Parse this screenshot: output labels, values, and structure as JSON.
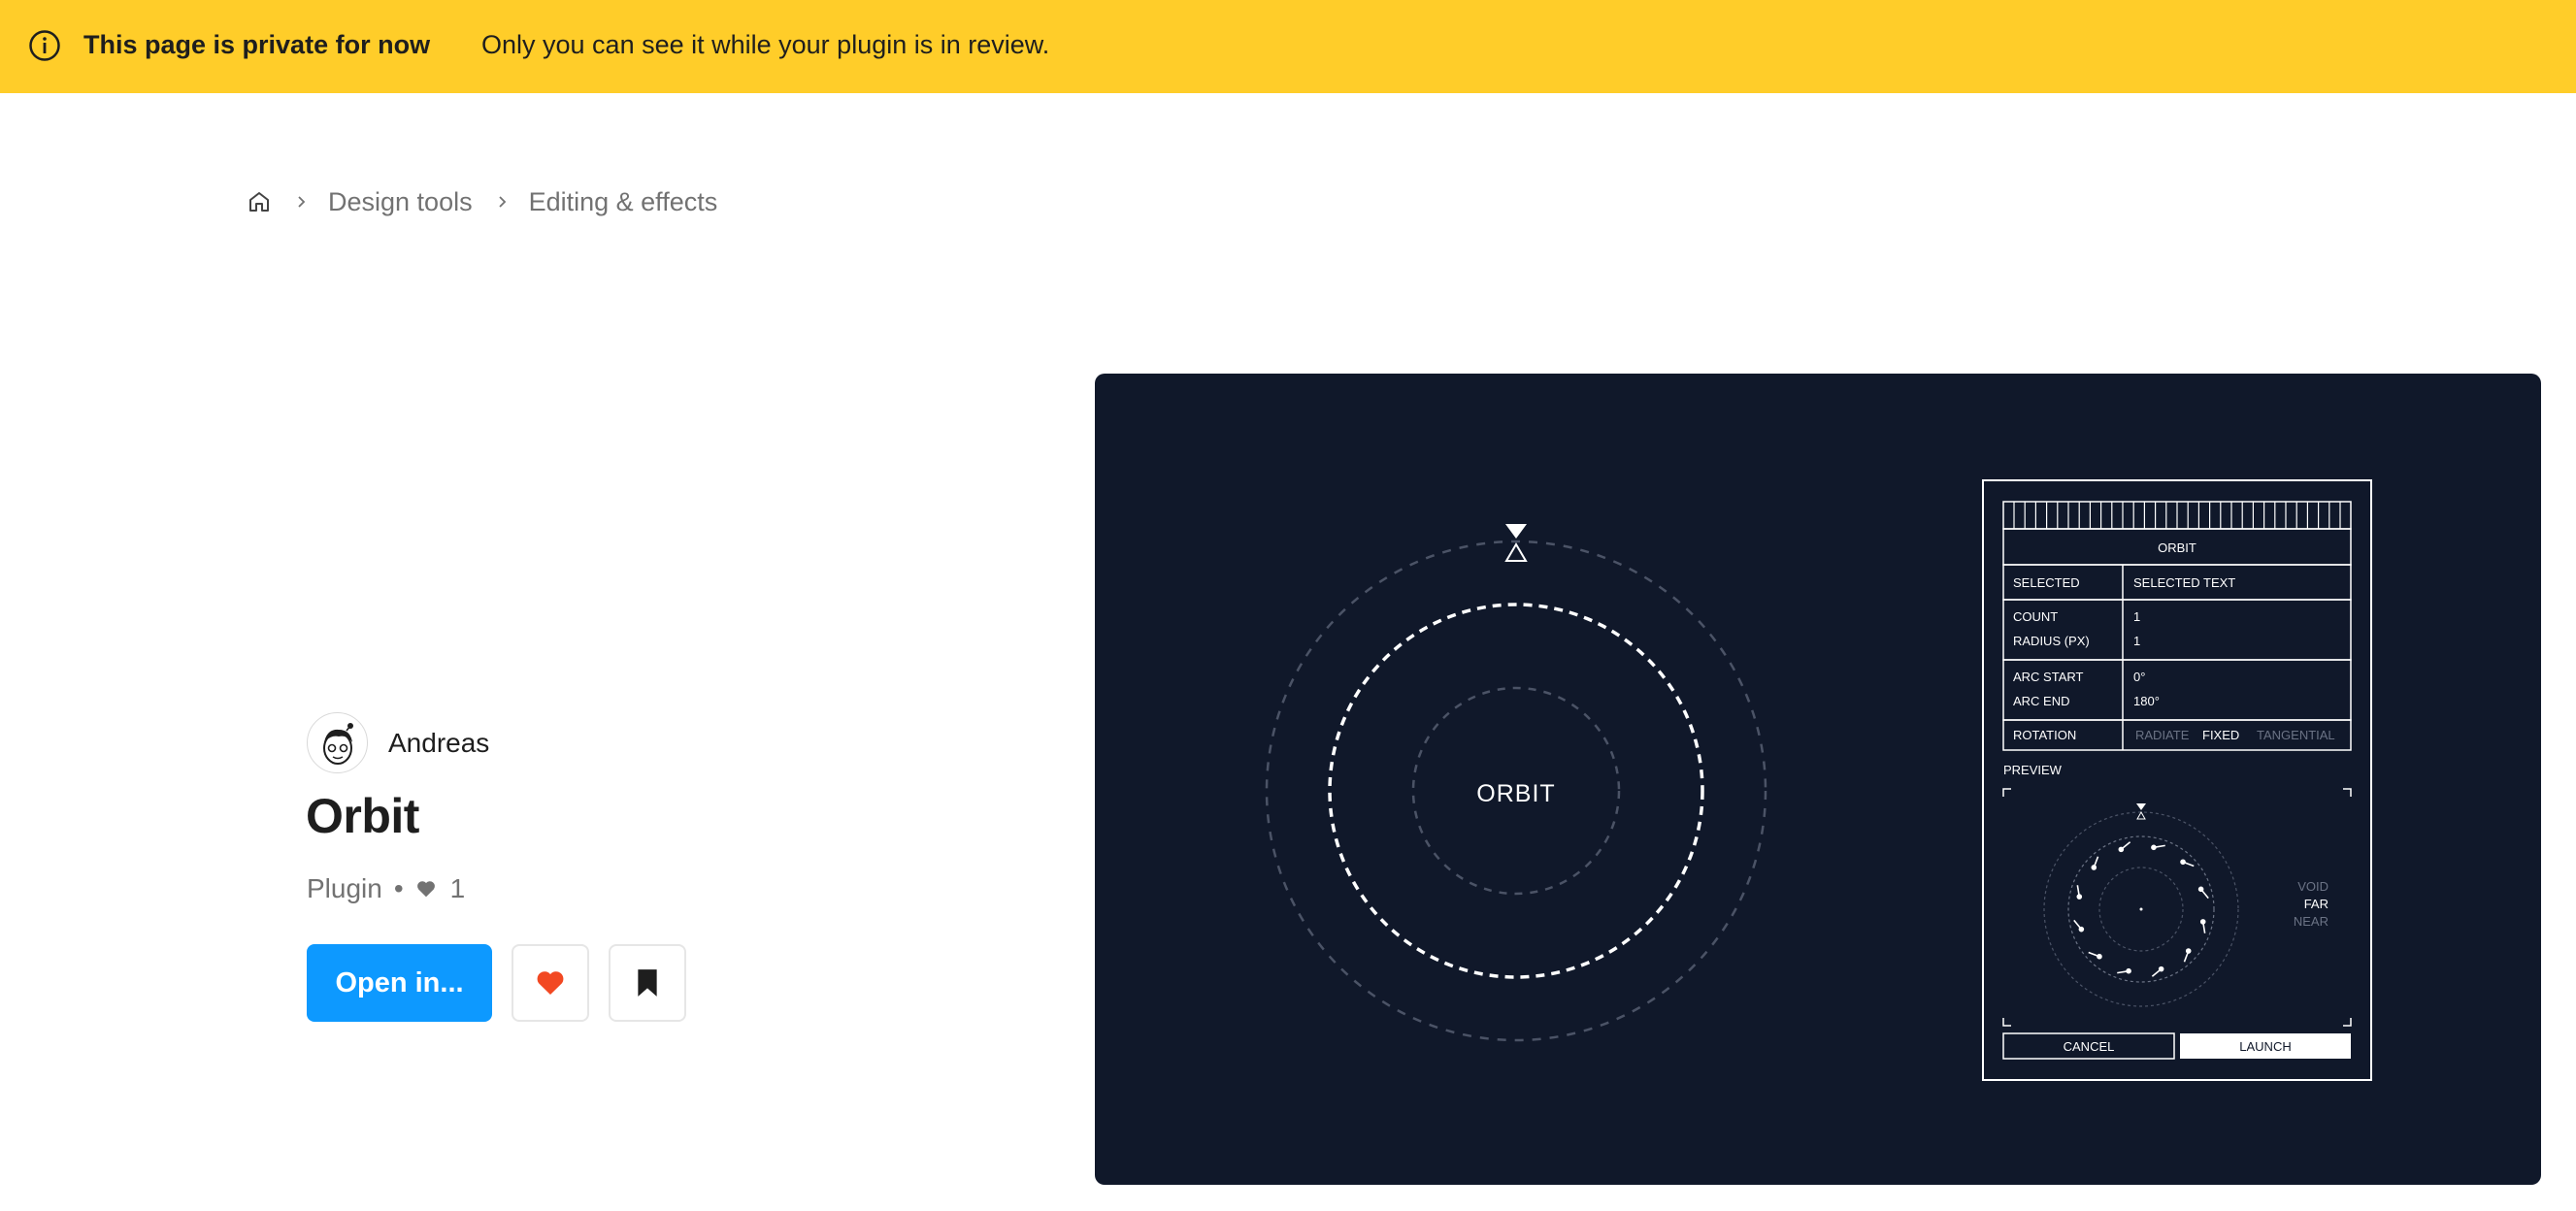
{
  "banner": {
    "icon": "info-icon",
    "title": "This page is private for now",
    "message": "Only you can see it while your plugin is in review."
  },
  "breadcrumb": {
    "home_icon": "home-icon",
    "items": [
      "Design tools",
      "Editing & effects"
    ]
  },
  "plugin": {
    "author": "Andreas",
    "name": "Orbit",
    "type": "Plugin",
    "separator": "•",
    "likes": "1",
    "open_label": "Open in..."
  },
  "colors": {
    "banner": "#ffcd29",
    "primary": "#0d99ff",
    "like": "#f24822",
    "preview_bg": "#10182a"
  },
  "preview": {
    "center_label": "ORBIT",
    "panel": {
      "title": "ORBIT",
      "rows": [
        {
          "label": "SELECTED",
          "value": "SELECTED TEXT"
        },
        {
          "label": "COUNT",
          "value": "1"
        },
        {
          "label": "RADIUS (PX)",
          "value": "1"
        },
        {
          "label": "ARC START",
          "value": "0°"
        },
        {
          "label": "ARC END",
          "value": "180°"
        }
      ],
      "rotation_label": "ROTATION",
      "rotation_options": [
        "RADIATE",
        "FIXED",
        "TANGENTIAL"
      ],
      "rotation_selected": "FIXED",
      "preview_label": "PREVIEW",
      "depth_options": [
        "VOID",
        "FAR",
        "NEAR"
      ],
      "depth_selected": "FAR",
      "cancel_label": "CANCEL",
      "launch_label": "LAUNCH"
    }
  }
}
